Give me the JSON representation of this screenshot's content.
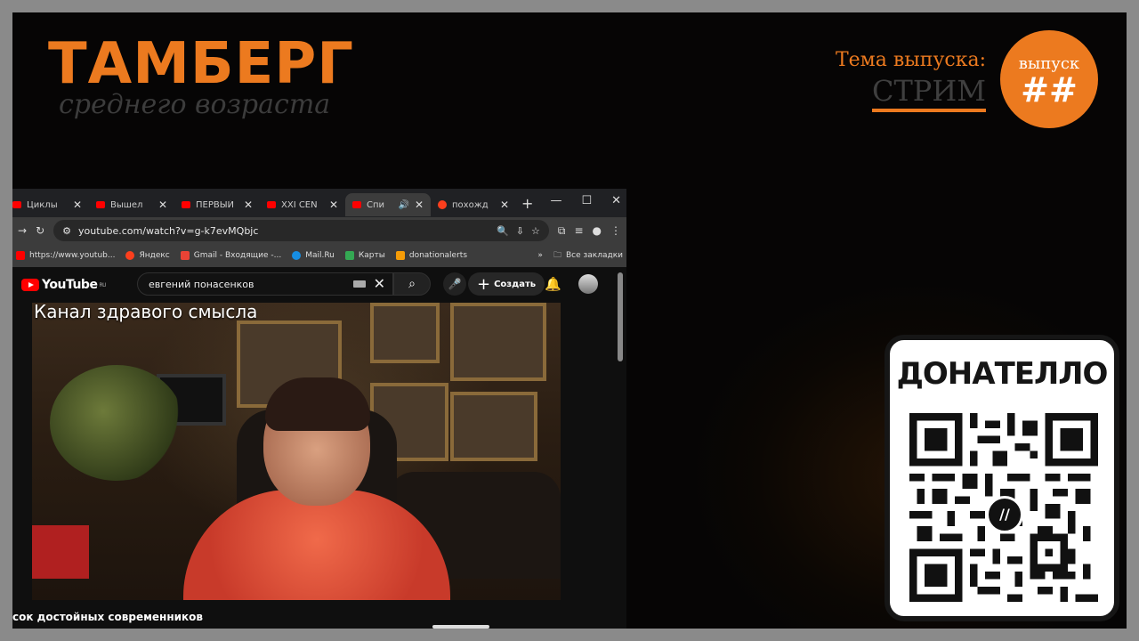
{
  "overlay": {
    "brand_title": "ТАМБЕРГ",
    "brand_subtitle": "среднего возраста",
    "topic_label": "Тема выпуска:",
    "topic_value": "СТРИМ",
    "episode_label": "выпуск",
    "episode_number": "##",
    "accent_color": "#ec7a1f"
  },
  "browser": {
    "tabs": [
      {
        "title": "Циклы"
      },
      {
        "title": "Вышел"
      },
      {
        "title": "ПЕРВЫЙ"
      },
      {
        "title": "XXI CEN"
      },
      {
        "title": "Спи",
        "active": true
      },
      {
        "title": "похожд"
      }
    ],
    "url": "youtube.com/watch?v=g-k7evMQbjc",
    "bookmarks": [
      "https://www.youtub...",
      "Яндекс",
      "Gmail - Входящие -...",
      "Mail.Ru",
      "Карты",
      "donationalerts"
    ],
    "all_bookmarks": "Все закладки"
  },
  "youtube": {
    "logo": "YouTube",
    "region": "RU",
    "search_query": "евгений понасенков",
    "create_label": "Создать",
    "video_overlay_title": "Канал здравого смысла",
    "caption": "сок достойных современников"
  },
  "donation": {
    "title": "ДОНАТЕЛЛО",
    "qr_icon": "donatello-logo-icon"
  }
}
